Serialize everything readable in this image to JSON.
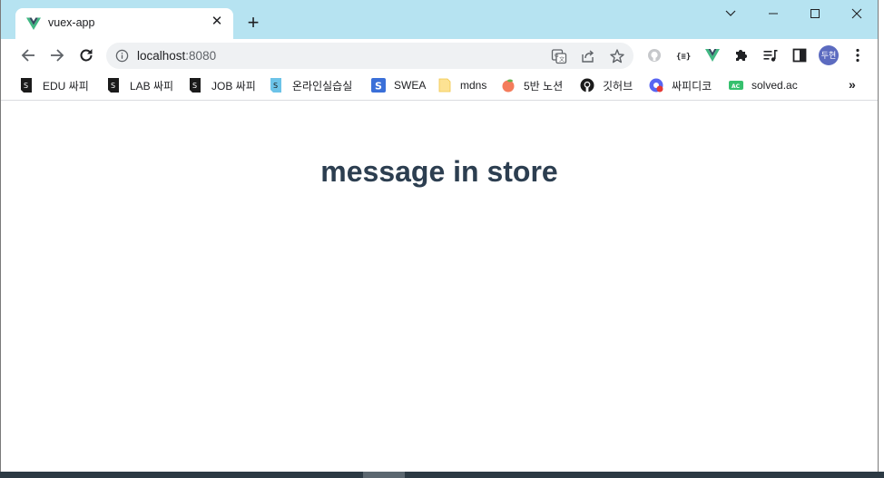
{
  "tab": {
    "title": "vuex-app",
    "favicon": "vue-logo-icon"
  },
  "address": {
    "host": "localhost",
    "port": ":8080"
  },
  "avatar": {
    "label": "두현",
    "color": "#5c6bc0"
  },
  "bookmarks": [
    {
      "label": "EDU 싸피",
      "icon": "ssafy-icon"
    },
    {
      "label": "LAB 싸피",
      "icon": "ssafy-icon"
    },
    {
      "label": "JOB 싸피",
      "icon": "ssafy-icon"
    },
    {
      "label": "온라인실습실",
      "icon": "ssafy-blue-icon"
    },
    {
      "label": "SWEA",
      "icon": "swea-icon"
    },
    {
      "label": "mdns",
      "icon": "folder-icon"
    },
    {
      "label": "5반 노션",
      "icon": "peach-icon"
    },
    {
      "label": "깃허브",
      "icon": "github-icon"
    },
    {
      "label": "싸피디코",
      "icon": "discord-chrome-icon"
    },
    {
      "label": "solved.ac",
      "icon": "solved-ac-icon"
    }
  ],
  "page": {
    "heading": "message in store"
  },
  "colors": {
    "titlebar": "#b6e3f1",
    "heading": "#2c3e50",
    "vue_green": "#41b883",
    "vue_dark": "#34495e"
  }
}
